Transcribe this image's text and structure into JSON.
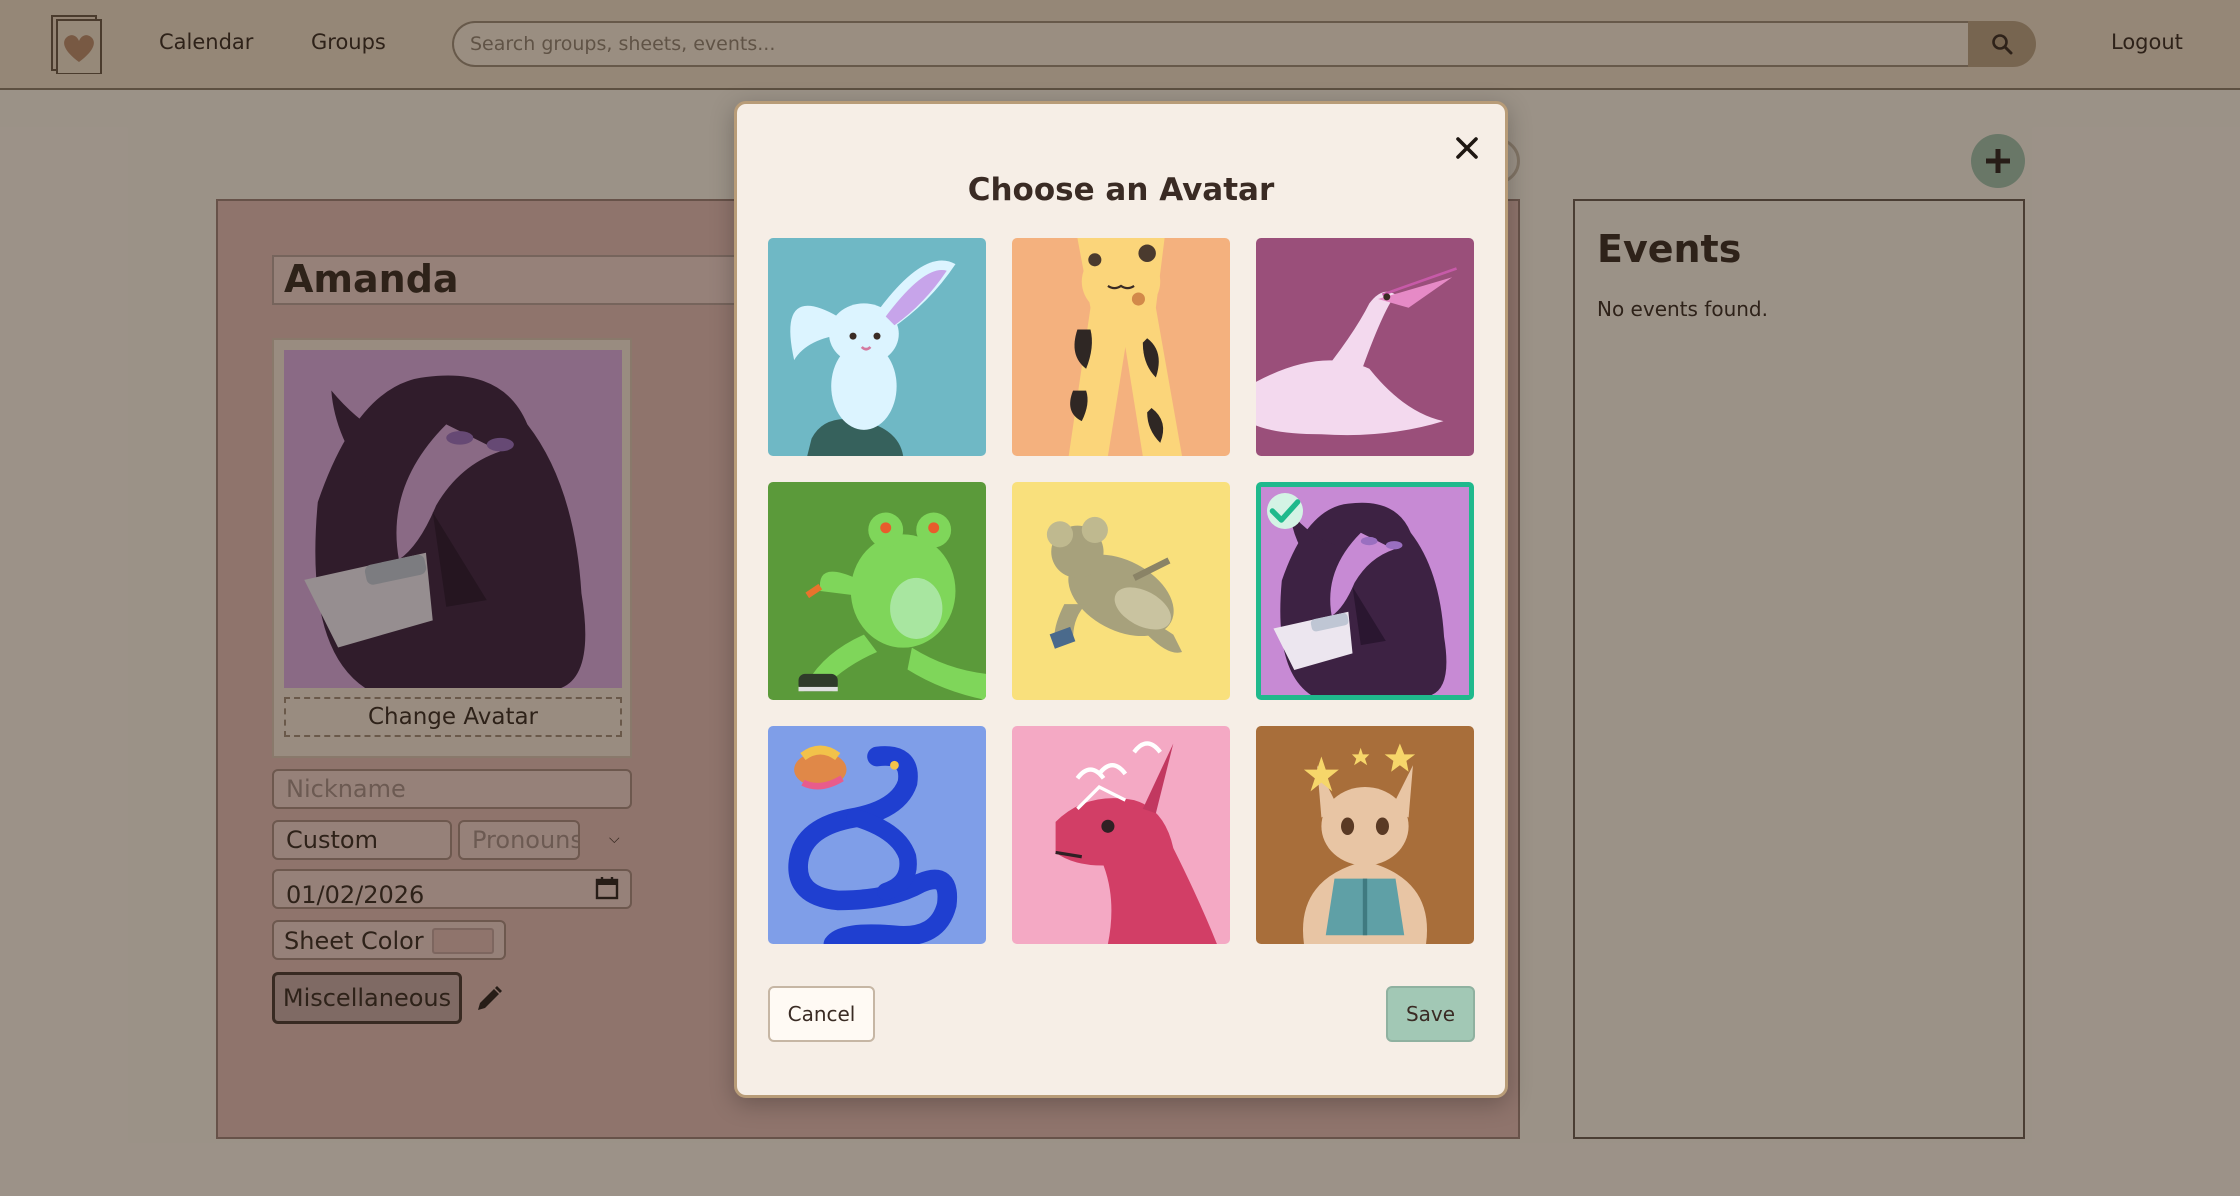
{
  "nav": {
    "calendar": "Calendar",
    "groups": "Groups",
    "search_placeholder": "Search groups, sheets, events...",
    "logout": "Logout"
  },
  "sheet": {
    "name": "Amanda",
    "change_avatar": "Change Avatar",
    "nickname_placeholder": "Nickname",
    "pronoun_select": "Custom",
    "pronoun_placeholder": "Pronouns",
    "date": "01/02/2026",
    "sheet_color_label": "Sheet Color",
    "sheet_color": "#e0b8b2",
    "miscellaneous": "Miscellaneous"
  },
  "events": {
    "title": "Events",
    "empty": "No events found."
  },
  "modal": {
    "title": "Choose an Avatar",
    "cancel": "Cancel",
    "save": "Save",
    "selected_index": 5,
    "avatars": [
      {
        "name": "bunny",
        "bg": "#6fb8c5"
      },
      {
        "name": "giraffe",
        "bg": "#f4b17e"
      },
      {
        "name": "heron",
        "bg": "#9a4f7a"
      },
      {
        "name": "frog",
        "bg": "#5b9a3a"
      },
      {
        "name": "koala",
        "bg": "#f9e07c"
      },
      {
        "name": "crow",
        "bg": "#c78ad4"
      },
      {
        "name": "snake",
        "bg": "#7f9ee8"
      },
      {
        "name": "unicorn",
        "bg": "#f4a9c4"
      },
      {
        "name": "fox",
        "bg": "#a86e3a"
      }
    ]
  },
  "colors": {
    "accent_selected": "#1fb98c",
    "save_button": "#a2c8b5",
    "header_bg": "#ebd9c4",
    "sheet_panel": "#e0b8b2"
  }
}
